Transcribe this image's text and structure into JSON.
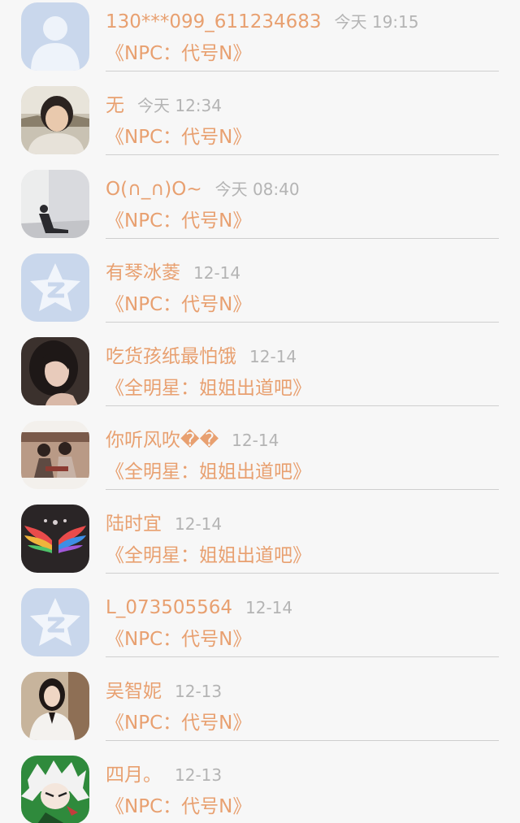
{
  "messages": [
    {
      "username": "130***099_611234683",
      "time": "今天 19:15",
      "game": "《NPC：代号N》",
      "avatar_icon": "default-person-avatar"
    },
    {
      "username": "无",
      "time": "今天 12:34",
      "game": "《NPC：代号N》",
      "avatar_icon": "girl-photo-avatar"
    },
    {
      "username": "O(∩_∩)O~",
      "time": "今天 08:40",
      "game": "《NPC：代号N》",
      "avatar_icon": "sitting-person-photo-avatar"
    },
    {
      "username": "有琴冰菱",
      "time": "12-14",
      "game": "《NPC：代号N》",
      "avatar_icon": "qzone-star-avatar"
    },
    {
      "username": "吃货孩纸最怕饿",
      "time": "12-14",
      "game": "《全明星：姐姐出道吧》",
      "avatar_icon": "dark-hair-girl-photo-avatar"
    },
    {
      "username": "你听风吹��",
      "time": "12-14",
      "game": "《全明星：姐姐出道吧》",
      "avatar_icon": "couple-photo-avatar"
    },
    {
      "username": "陆时宜",
      "time": "12-14",
      "game": "《全明星：姐姐出道吧》",
      "avatar_icon": "rainbow-wings-avatar"
    },
    {
      "username": "L_073505564",
      "time": "12-14",
      "game": "《NPC：代号N》",
      "avatar_icon": "qzone-star-avatar"
    },
    {
      "username": "吴智妮",
      "time": "12-13",
      "game": "《NPC：代号N》",
      "avatar_icon": "girl-white-jacket-photo-avatar"
    },
    {
      "username": "四月。",
      "time": "12-13",
      "game": "《NPC：代号N》",
      "avatar_icon": "anime-character-avatar"
    }
  ],
  "colors": {
    "background": "#f7f7f7",
    "username": "#e8a070",
    "game_title": "#e8a070",
    "timestamp": "#b4b4b4",
    "divider": "#cfcfcf"
  }
}
